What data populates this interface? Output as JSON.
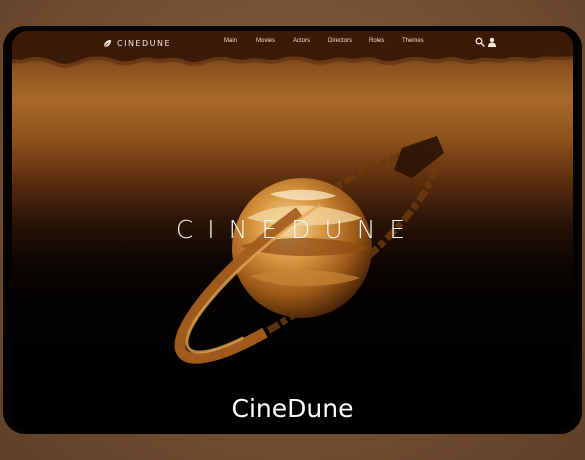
{
  "brand": {
    "logo_text": "CINEDUNE",
    "logo_icon": "leaf-icon"
  },
  "nav": {
    "items": [
      "Main",
      "Movies",
      "Actors",
      "Directors",
      "Roles",
      "Themes"
    ]
  },
  "toolbar": {
    "search_icon": "search-icon",
    "user_icon": "user-icon"
  },
  "hero": {
    "title": "CINEDUNE"
  },
  "caption": "CineDune",
  "colors": {
    "topbar": "#3b1a07",
    "sky_mid": "#a86a2a",
    "planet_light": "#f2c98a",
    "planet_dark": "#7a4512"
  }
}
